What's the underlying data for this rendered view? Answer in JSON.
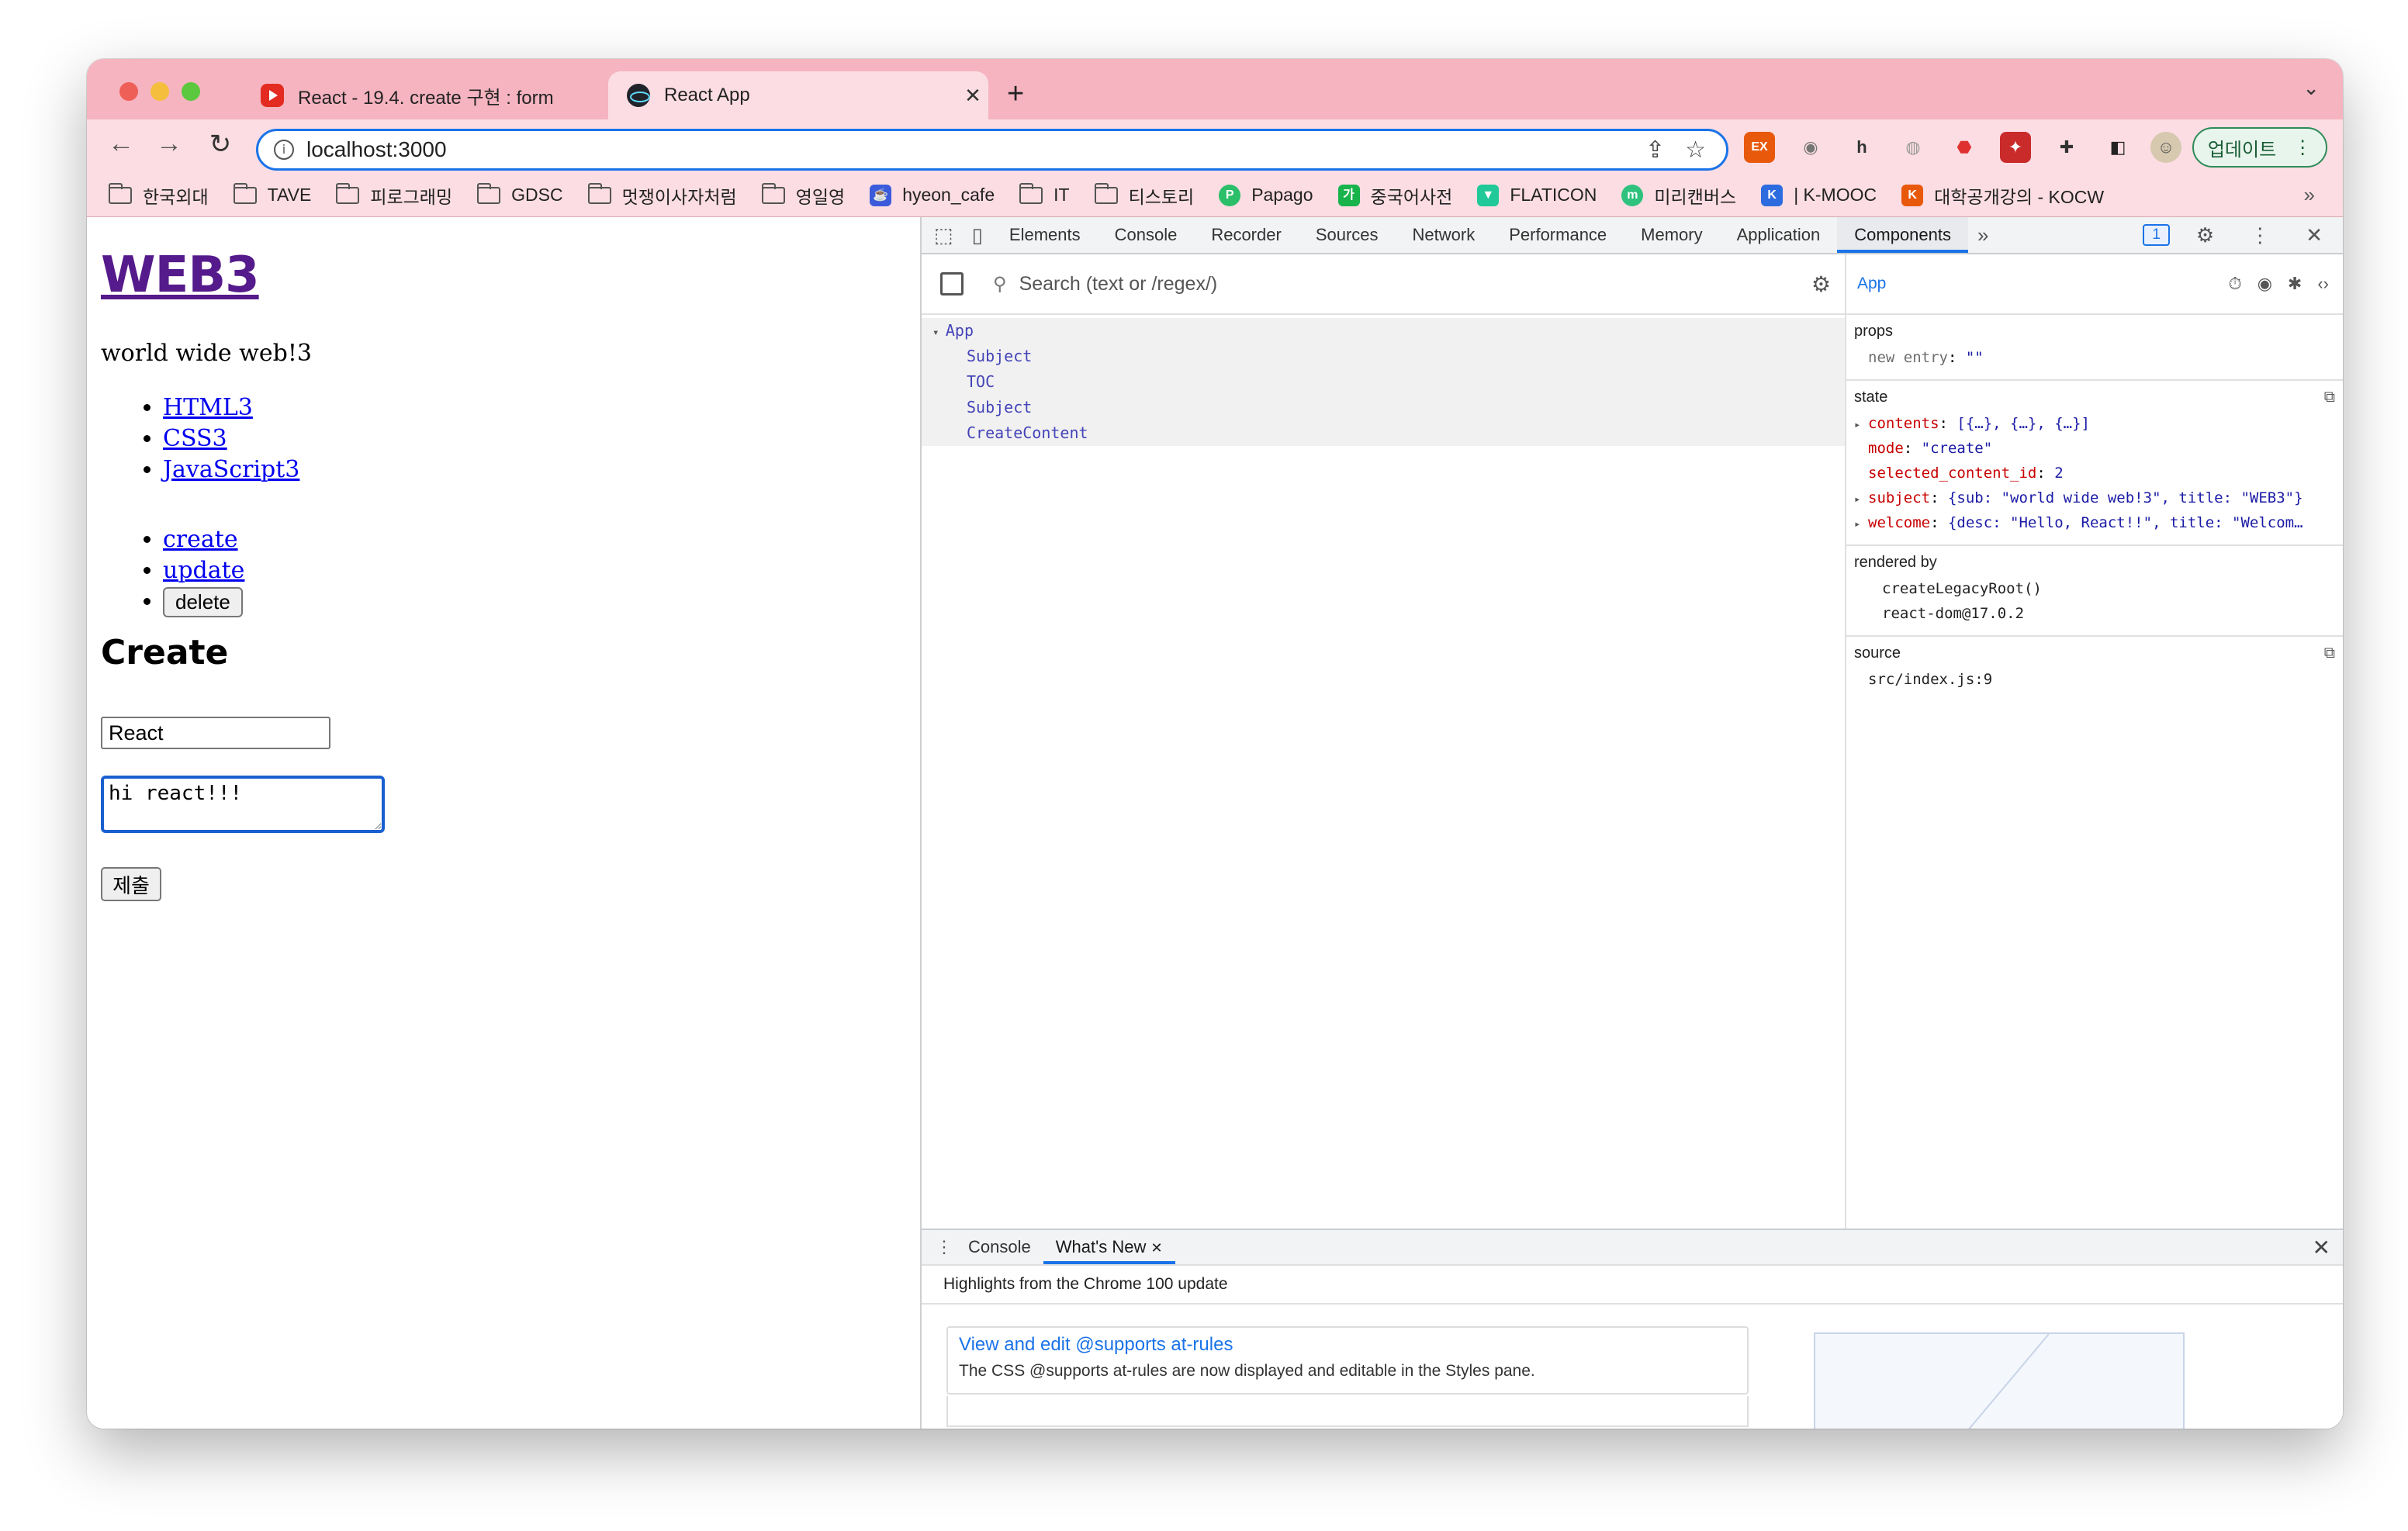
{
  "browser": {
    "tabs": [
      {
        "title": "React - 19.4. create 구현 : form",
        "icon": "youtube-icon"
      },
      {
        "title": "React App",
        "icon": "react-icon"
      }
    ],
    "url": "localhost:3000",
    "update_label": "업데이트",
    "bookmarks": [
      {
        "label": "한국외대",
        "icon": "folder-icon"
      },
      {
        "label": "TAVE",
        "icon": "folder-icon"
      },
      {
        "label": "피로그래밍",
        "icon": "folder-icon"
      },
      {
        "label": "GDSC",
        "icon": "folder-icon"
      },
      {
        "label": "멋쟁이사자처럼",
        "icon": "folder-icon"
      },
      {
        "label": "영일영",
        "icon": "folder-icon"
      },
      {
        "label": "hyeon_cafe",
        "icon": "cafe-icon",
        "color": "#3b5bdb"
      },
      {
        "label": "IT",
        "icon": "folder-icon"
      },
      {
        "label": "티스토리",
        "icon": "folder-icon"
      },
      {
        "label": "Papago",
        "icon": "papago-icon",
        "color": "#2bbf6a"
      },
      {
        "label": "중국어사전",
        "icon": "dictionary-icon",
        "color": "#19b34c"
      },
      {
        "label": "FLATICON",
        "icon": "flaticon-icon",
        "color": "#20c997"
      },
      {
        "label": "미리캔버스",
        "icon": "miricanvas-icon",
        "color": "#2ec27e"
      },
      {
        "label": "| K-MOOC",
        "icon": "kmooc-icon",
        "color": "#2d6cdf"
      },
      {
        "label": "대학공개강의 - KOCW",
        "icon": "kocw-icon",
        "color": "#e8590c"
      }
    ]
  },
  "page": {
    "title": "WEB3",
    "description": "world wide web!3",
    "toc": [
      "HTML3",
      "CSS3",
      "JavaScript3"
    ],
    "controls": {
      "create": "create",
      "update": "update",
      "delete": "delete"
    },
    "form_heading": "Create",
    "title_value": "React",
    "desc_value": "hi react!!!",
    "submit_label": "제출"
  },
  "devtools": {
    "tabs": [
      "Elements",
      "Console",
      "Recorder",
      "Sources",
      "Network",
      "Performance",
      "Memory",
      "Application",
      "Components"
    ],
    "active_tab": "Components",
    "issues_count": "1",
    "search_placeholder": "Search (text or /regex/)",
    "tree": {
      "root": "App",
      "children": [
        "Subject",
        "TOC",
        "Subject",
        "CreateContent"
      ]
    },
    "selected_component": "App",
    "props_title": "props",
    "props": [
      {
        "key": "new entry",
        "value": "\"\""
      }
    ],
    "state_title": "state",
    "state": [
      {
        "key": "contents",
        "value": "[{…}, {…}, {…}]",
        "expandable": true
      },
      {
        "key": "mode",
        "value": "\"create\"",
        "expandable": false
      },
      {
        "key": "selected_content_id",
        "value": "2",
        "expandable": false
      },
      {
        "key": "subject",
        "value": "{sub: \"world wide web!3\", title: \"WEB3\"}",
        "expandable": true
      },
      {
        "key": "welcome",
        "value": "{desc: \"Hello, React!!\", title: \"Welcom…",
        "expandable": true
      }
    ],
    "rendered_by_title": "rendered by",
    "rendered_by": [
      "createLegacyRoot()",
      "react-dom@17.0.2"
    ],
    "source_title": "source",
    "source": "src/index.js:9",
    "drawer": {
      "tabs": [
        "Console",
        "What's New"
      ],
      "active": "What's New",
      "highlight": "Highlights from the Chrome 100 update",
      "card_title": "View and edit @supports at-rules",
      "card_desc": "The CSS @supports at-rules are now displayed and editable in the Styles pane."
    }
  }
}
